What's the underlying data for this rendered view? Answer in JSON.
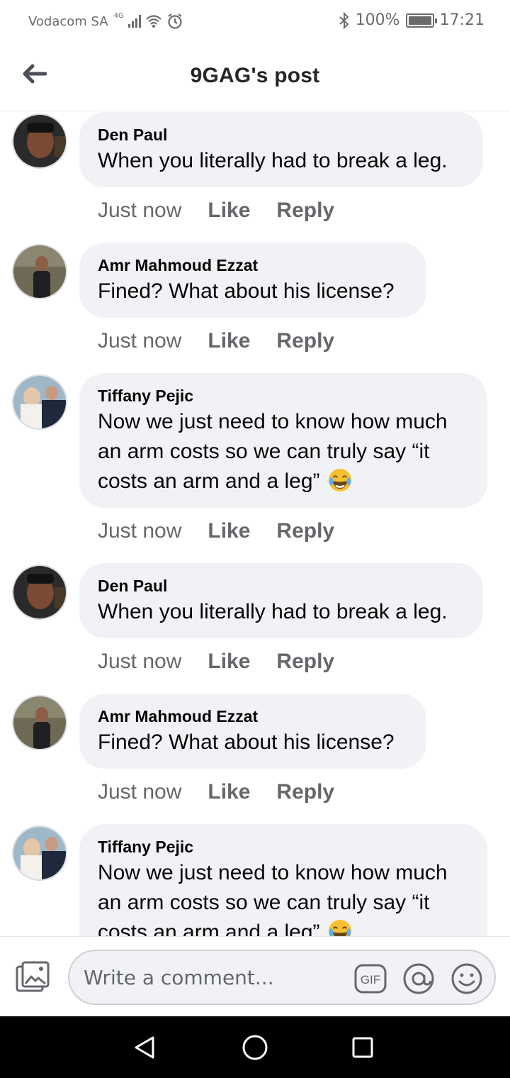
{
  "status_bar": {
    "carrier": "Vodacom SA",
    "network": "4G",
    "battery": "100%",
    "time": "17:21"
  },
  "header": {
    "title": "9GAG's post"
  },
  "meta_labels": {
    "time": "Just now",
    "like": "Like",
    "reply": "Reply"
  },
  "comments": [
    {
      "author": "Den Paul",
      "lines": [
        "When you literally had to break a leg."
      ],
      "emoji": false
    },
    {
      "author": "Amr Mahmoud Ezzat",
      "lines": [
        "Fined? What about his license?"
      ],
      "emoji": false
    },
    {
      "author": "Tiffany Pejic",
      "lines": [
        "Now we just need to know how much",
        "an arm costs so we can truly say “it",
        "costs an arm and a leg”"
      ],
      "emoji": true
    },
    {
      "author": "Den Paul",
      "lines": [
        "When you literally had to break a leg."
      ],
      "emoji": false
    },
    {
      "author": "Amr Mahmoud Ezzat",
      "lines": [
        "Fined? What about his license?"
      ],
      "emoji": false
    },
    {
      "author": "Tiffany Pejic",
      "lines": [
        "Now we just need to know how much",
        "an arm costs so we can truly say “it",
        "costs an arm and a leg”"
      ],
      "emoji": true
    }
  ],
  "composer": {
    "placeholder": "Write a comment...",
    "gif_label": "GIF"
  },
  "icons": {
    "back": "arrow-left-icon",
    "photo": "photo-icon",
    "gif": "gif-icon",
    "mention": "at-sign-icon",
    "emoji": "smiley-icon",
    "nav_back": "triangle-back-icon",
    "nav_home": "circle-home-icon",
    "nav_recents": "square-recents-icon"
  }
}
